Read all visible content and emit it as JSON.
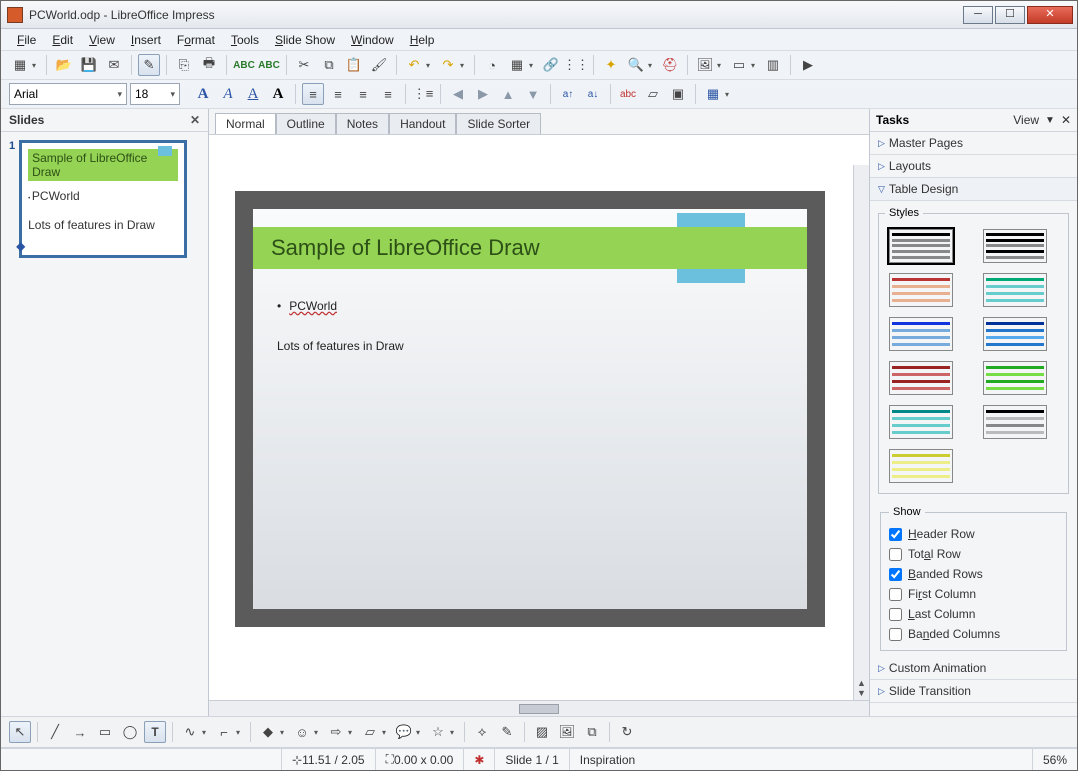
{
  "window": {
    "title": "PCWorld.odp - LibreOffice Impress"
  },
  "menus": [
    "File",
    "Edit",
    "View",
    "Insert",
    "Format",
    "Tools",
    "Slide Show",
    "Window",
    "Help"
  ],
  "font": {
    "name": "Arial",
    "size": "18"
  },
  "slides_pane": {
    "title": "Slides",
    "slide_number": "1"
  },
  "view_tabs": [
    "Normal",
    "Outline",
    "Notes",
    "Handout",
    "Slide Sorter"
  ],
  "slide": {
    "title": "Sample of LibreOffice Draw",
    "bullet1": "PCWorld",
    "body": "Lots of features in Draw"
  },
  "tasks": {
    "title": "Tasks",
    "view_label": "View",
    "sections": {
      "master": "Master Pages",
      "layouts": "Layouts",
      "table": "Table Design",
      "custom": "Custom Animation",
      "trans": "Slide Transition"
    },
    "styles_legend": "Styles",
    "show_legend": "Show",
    "show_opts": {
      "header": "Header Row",
      "total": "Total Row",
      "banded_r": "Banded Rows",
      "first_c": "First Column",
      "last_c": "Last Column",
      "banded_c": "Banded Columns"
    }
  },
  "status": {
    "coords": "11.51 / 2.05",
    "size": "0.00 x 0.00",
    "slide": "Slide 1 / 1",
    "template": "Inspiration",
    "zoom": "56%"
  }
}
